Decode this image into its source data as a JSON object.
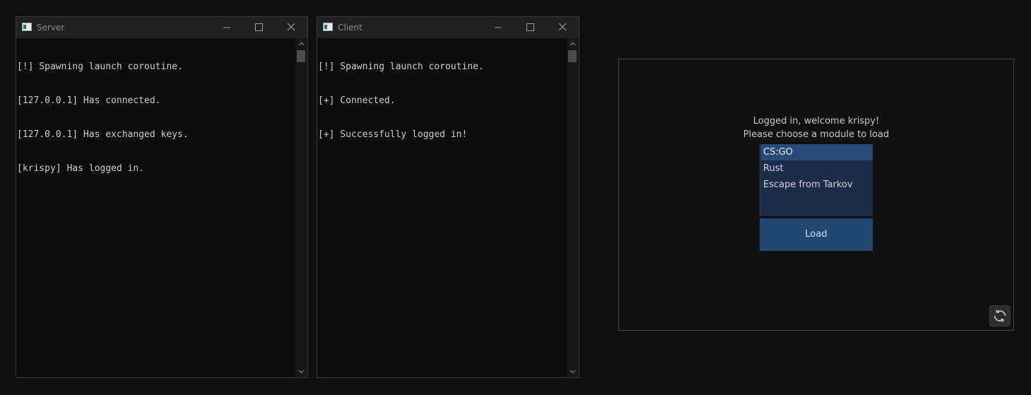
{
  "server_window": {
    "title": "Server",
    "lines": [
      "[!] Spawning launch coroutine.",
      "[127.0.0.1] Has connected.",
      "[127.0.0.1] Has exchanged keys.",
      "[krispy] Has logged in."
    ]
  },
  "client_window": {
    "title": "Client",
    "lines": [
      "[!] Spawning launch coroutine.",
      "[+] Connected.",
      "[+] Successfully logged in!"
    ]
  },
  "window_controls": {
    "minimize_icon": "minimize-icon",
    "maximize_icon": "maximize-icon",
    "close_icon": "close-icon"
  },
  "loader": {
    "welcome_line_1": "Logged in, welcome krispy!",
    "welcome_line_2": "Please choose a module to load",
    "modules": [
      {
        "label": "CS:GO",
        "selected": true
      },
      {
        "label": "Rust",
        "selected": false
      },
      {
        "label": "Escape from Tarkov",
        "selected": false
      }
    ],
    "load_label": "Load",
    "refresh_icon": "refresh-icon"
  },
  "colors": {
    "background": "#0f0f0f",
    "list_background": "#1c2c48",
    "selected_item": "#264b78",
    "button": "#224773",
    "console_text": "#cccccc"
  }
}
